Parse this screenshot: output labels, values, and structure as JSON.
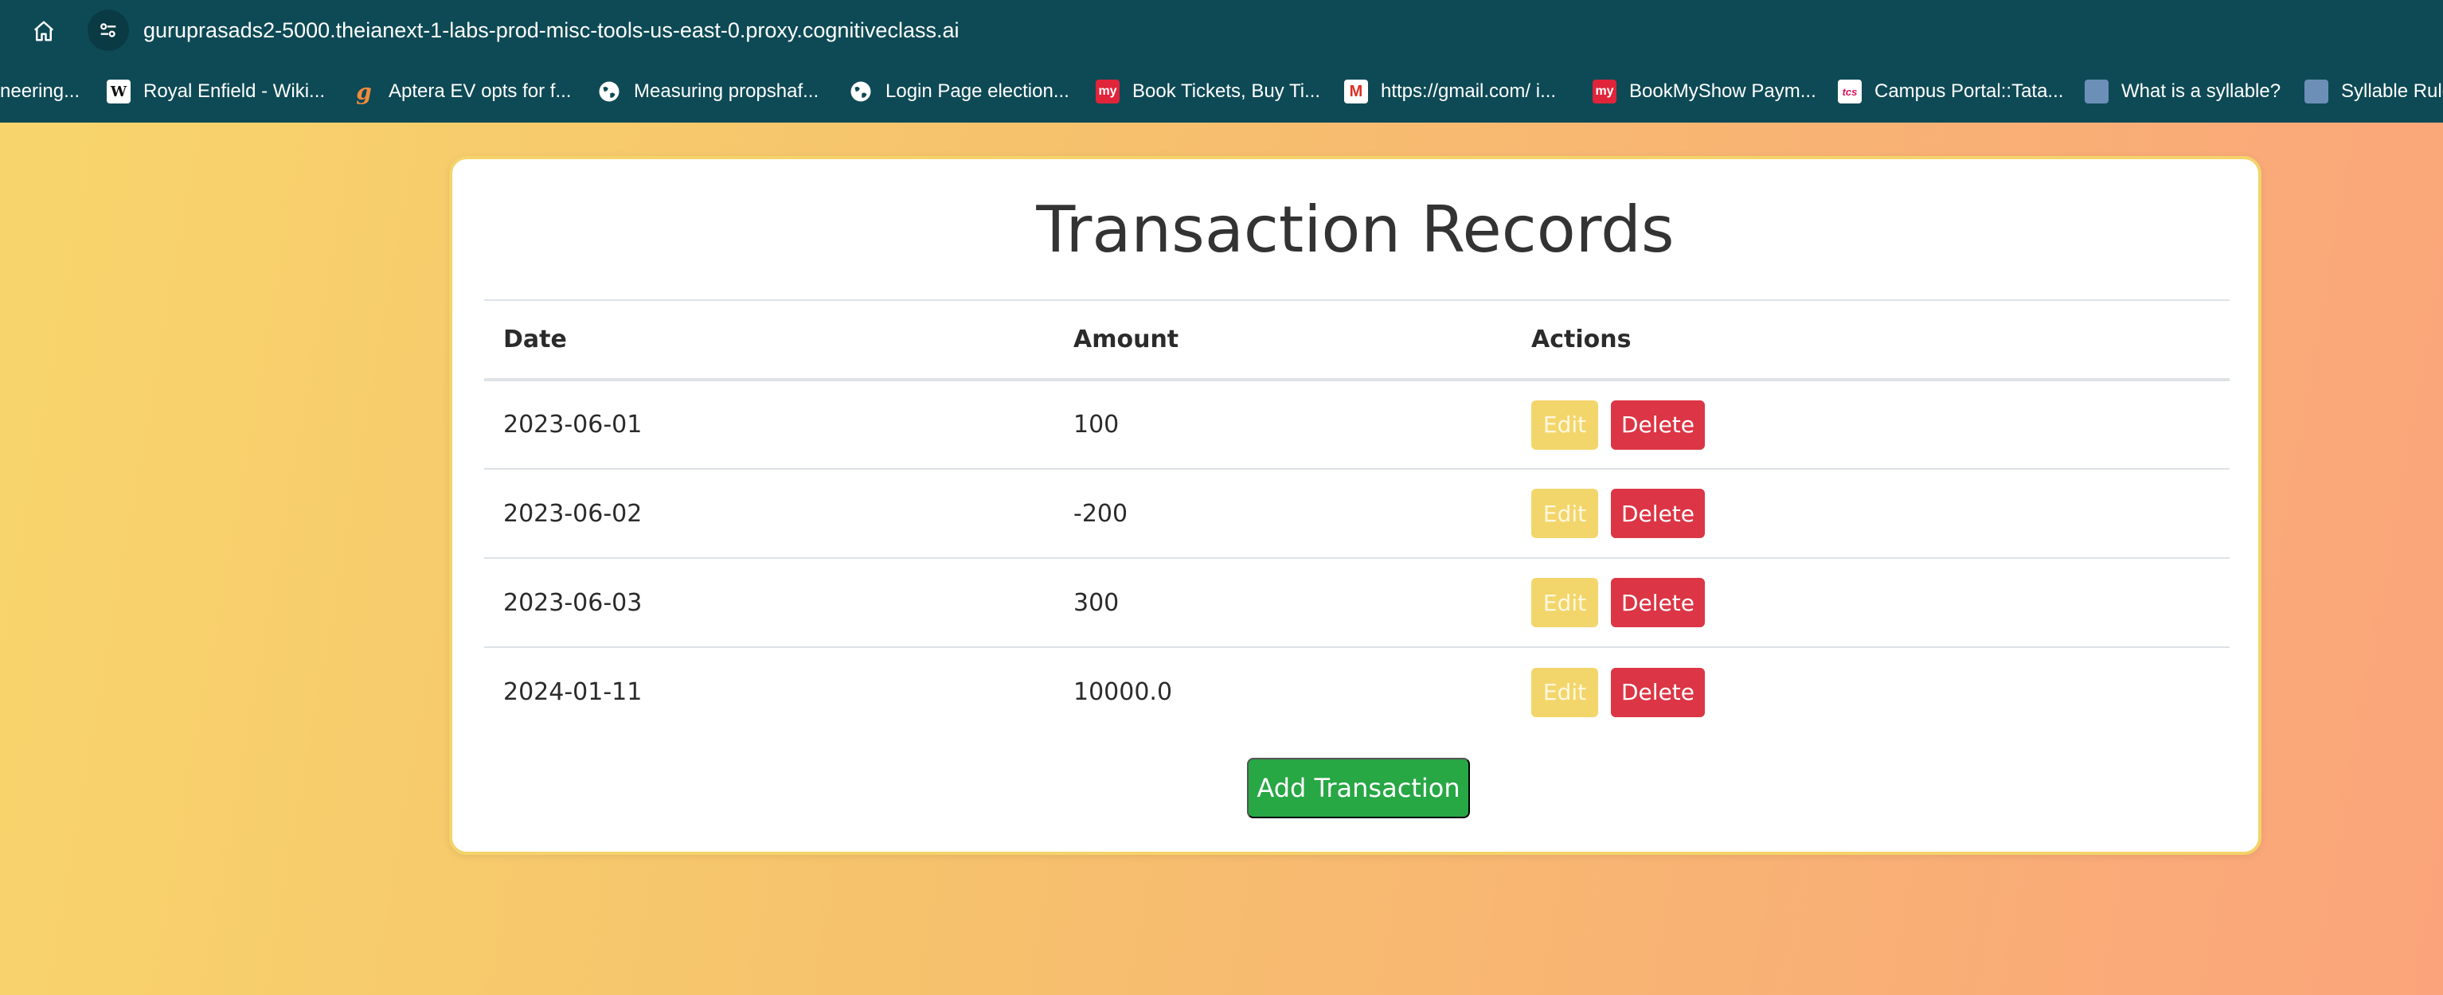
{
  "browser": {
    "url": "guruprasads2-5000.theianext-1-labs-prod-misc-tools-us-east-0.proxy.cognitiveclass.ai",
    "bookmarks": [
      {
        "label": "neering...",
        "icon": ""
      },
      {
        "label": "Royal Enfield - Wiki...",
        "icon": "W"
      },
      {
        "label": "Aptera EV opts for f...",
        "icon": "g"
      },
      {
        "label": "Measuring propshaf...",
        "icon": "globe"
      },
      {
        "label": "Login Page election...",
        "icon": "globe"
      },
      {
        "label": "Book Tickets, Buy Ti...",
        "icon": "my"
      },
      {
        "label": "https://gmail.com/ i...",
        "icon": "M"
      },
      {
        "label": "BookMyShow Paym...",
        "icon": "my"
      },
      {
        "label": "Campus Portal::Tata...",
        "icon": "tcs"
      },
      {
        "label": "What is a syllable?",
        "icon": "img"
      },
      {
        "label": "Syllable Rule",
        "icon": "img"
      }
    ]
  },
  "page": {
    "title": "Transaction Records",
    "table": {
      "headers": {
        "date": "Date",
        "amount": "Amount",
        "actions": "Actions"
      },
      "rows": [
        {
          "date": "2023-06-01",
          "amount": "100"
        },
        {
          "date": "2023-06-02",
          "amount": "-200"
        },
        {
          "date": "2023-06-03",
          "amount": "300"
        },
        {
          "date": "2024-01-11",
          "amount": "10000.0"
        }
      ],
      "edit_label": "Edit",
      "delete_label": "Delete"
    },
    "add_label": "Add Transaction"
  },
  "colors": {
    "chrome": "#0e4a55",
    "edit": "#f3d66b",
    "delete": "#dc3545",
    "add": "#28a745",
    "card_border": "#f4d36a"
  }
}
